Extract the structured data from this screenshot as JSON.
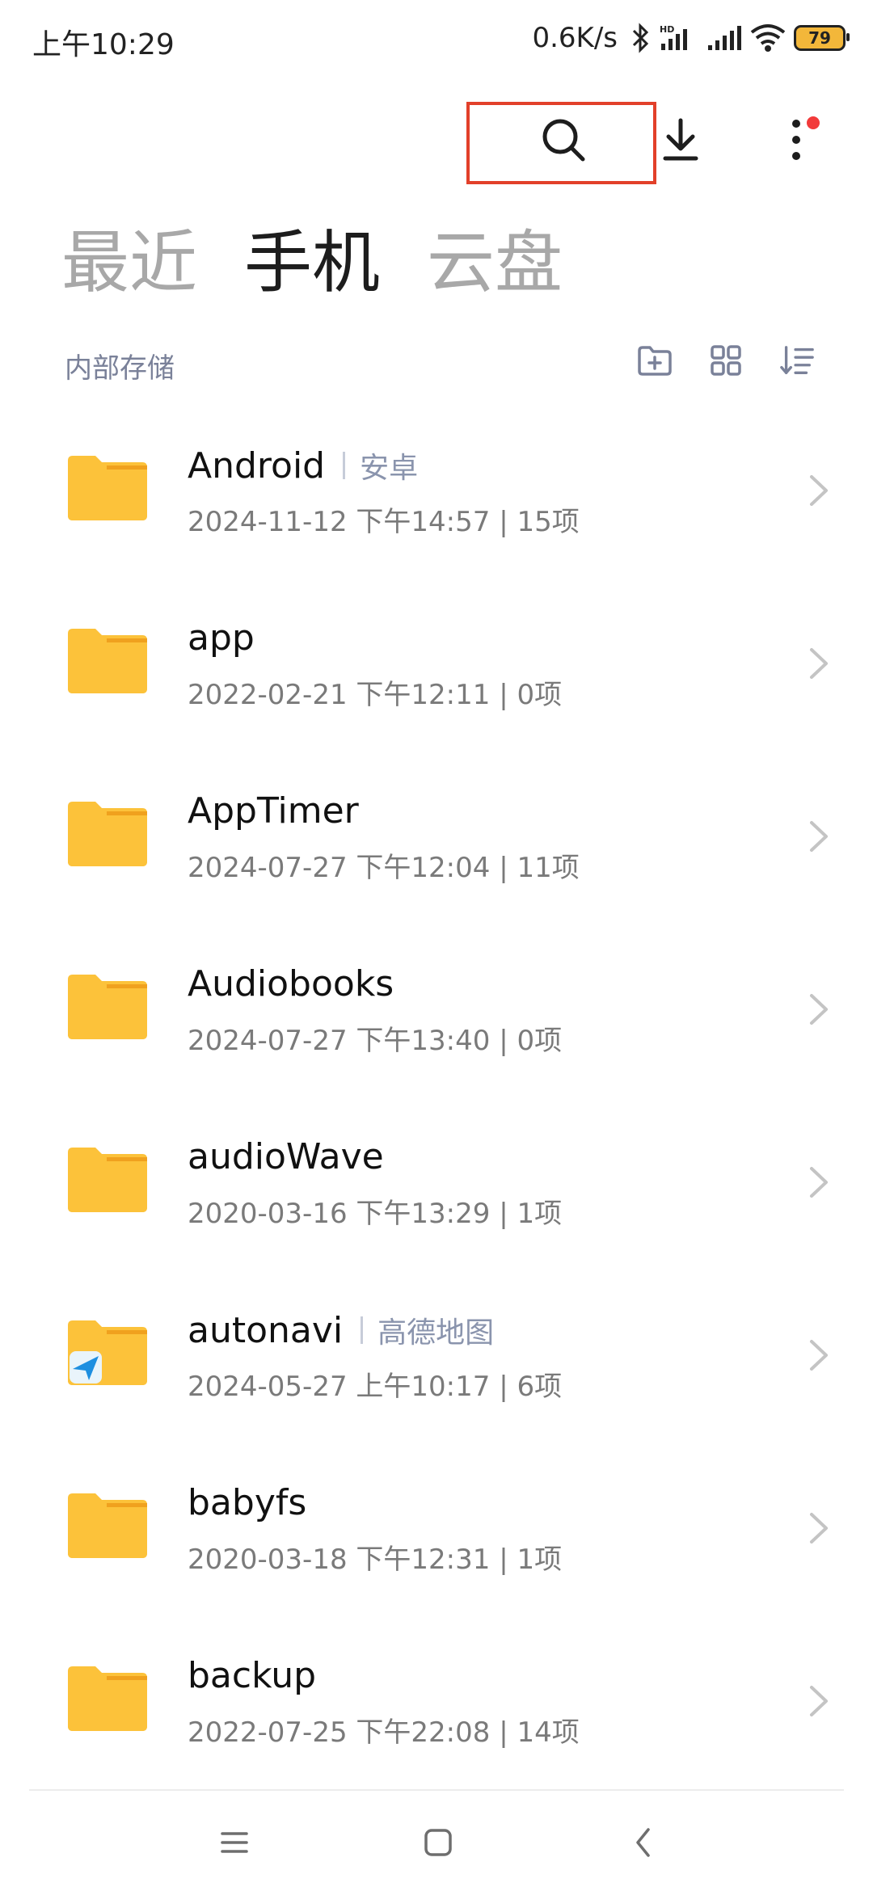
{
  "status_bar": {
    "time": "上午10:29",
    "net_speed": "0.6K/s",
    "battery": "79",
    "icons": [
      "bluetooth-icon",
      "hd-signal-icon",
      "signal-icon",
      "wifi-icon",
      "battery-icon"
    ]
  },
  "toolbar": {
    "icons": [
      "search-icon",
      "download-icon",
      "more-vert-icon"
    ],
    "highlight_color": "#e2402a",
    "notification_dot_color": "#f23a3a"
  },
  "tabs": [
    {
      "label": "最近",
      "active": false
    },
    {
      "label": "手机",
      "active": true
    },
    {
      "label": "云盘",
      "active": false
    }
  ],
  "section": {
    "title": "内部存储",
    "actions": [
      "new-folder-icon",
      "grid-view-icon",
      "sort-icon"
    ]
  },
  "folders": [
    {
      "name": "Android",
      "tag": "安卓",
      "meta": "2024-11-12 下午14:57 | 15项"
    },
    {
      "name": "app",
      "tag": "",
      "meta": "2022-02-21 下午12:11 | 0项"
    },
    {
      "name": "AppTimer",
      "tag": "",
      "meta": "2024-07-27 下午12:04 | 11项"
    },
    {
      "name": "Audiobooks",
      "tag": "",
      "meta": "2024-07-27 下午13:40 | 0项"
    },
    {
      "name": "audioWave",
      "tag": "",
      "meta": "2020-03-16 下午13:29 | 1项"
    },
    {
      "name": "autonavi",
      "tag": "高德地图",
      "meta": "2024-05-27 上午10:17 | 6项"
    },
    {
      "name": "babyfs",
      "tag": "",
      "meta": "2020-03-18 下午12:31 | 1项"
    },
    {
      "name": "backup",
      "tag": "",
      "meta": "2022-07-25 下午22:08 | 14项"
    }
  ],
  "colors": {
    "folder": "#fcc23a",
    "folder_tab": "#f0a11e",
    "accent_text": "#7a8199"
  },
  "nav_bar": {
    "icons": [
      "menu-icon",
      "home-icon",
      "back-icon"
    ]
  }
}
